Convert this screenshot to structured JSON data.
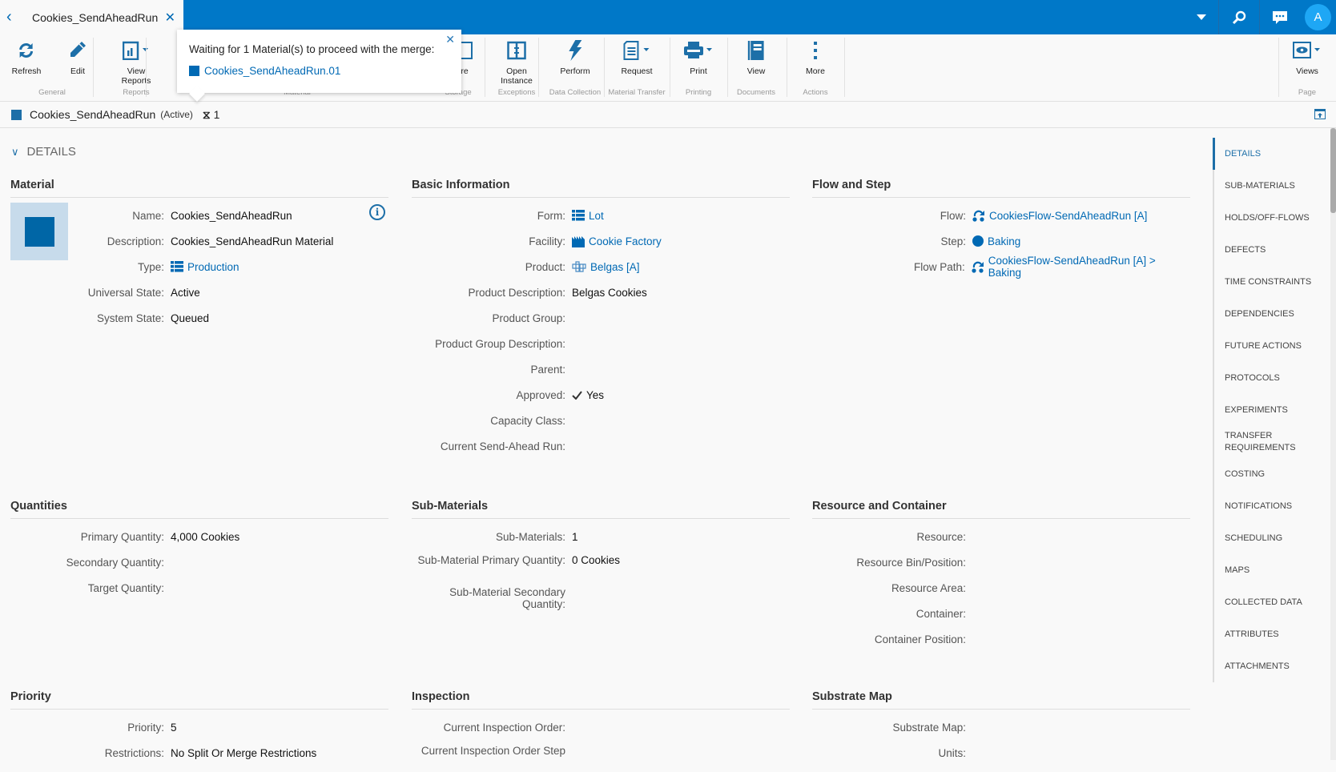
{
  "tab": {
    "title": "Cookies_SendAheadRun"
  },
  "header": {
    "avatar": "A"
  },
  "toolbar": {
    "buttons": [
      {
        "label": "Refresh",
        "icon": "refresh-icon"
      },
      {
        "label": "Edit",
        "icon": "pencil-icon"
      },
      {
        "label": "View Reports",
        "icon": "report-icon"
      },
      {
        "label": "re",
        "icon": "store-icon"
      },
      {
        "label": "Open Instance",
        "icon": "exception-icon"
      },
      {
        "label": "Perform",
        "icon": "lightning-icon"
      },
      {
        "label": "Request",
        "icon": "document-icon"
      },
      {
        "label": "Print",
        "icon": "printer-icon"
      },
      {
        "label": "View",
        "icon": "book-icon"
      },
      {
        "label": "More",
        "icon": "more-icon"
      },
      {
        "label": "Views",
        "icon": "eye-icon"
      }
    ],
    "groups": [
      "General",
      "Reports",
      "Material",
      "Storage",
      "Exceptions",
      "Data Collection",
      "Material Transfer",
      "Printing",
      "Documents",
      "Actions",
      "Page"
    ]
  },
  "popup": {
    "message": "Waiting for 1 Material(s) to proceed with the merge:",
    "link": "Cookies_SendAheadRun.01"
  },
  "material_bar": {
    "name": "Cookies_SendAheadRun",
    "state": "(Active)",
    "count": "1"
  },
  "details": {
    "heading": "DETAILS"
  },
  "sections": {
    "material": {
      "title": "Material",
      "rows": [
        {
          "label": "Name:",
          "value": "Cookies_SendAheadRun"
        },
        {
          "label": "Description:",
          "value": "Cookies_SendAheadRun Material"
        },
        {
          "label": "Type:",
          "value": "Production"
        },
        {
          "label": "Universal State:",
          "value": "Active"
        },
        {
          "label": "System State:",
          "value": "Queued"
        }
      ]
    },
    "basic": {
      "title": "Basic Information",
      "rows": [
        {
          "label": "Form:",
          "value": "Lot"
        },
        {
          "label": "Facility:",
          "value": "Cookie Factory"
        },
        {
          "label": "Product:",
          "value": "Belgas [A]"
        },
        {
          "label": "Product Description:",
          "value": "Belgas Cookies"
        },
        {
          "label": "Product Group:",
          "value": ""
        },
        {
          "label": "Product Group Description:",
          "value": ""
        },
        {
          "label": "Parent:",
          "value": ""
        },
        {
          "label": "Approved:",
          "value": "Yes"
        },
        {
          "label": "Capacity Class:",
          "value": ""
        },
        {
          "label": "Current Send-Ahead Run:",
          "value": ""
        }
      ]
    },
    "flow": {
      "title": "Flow and Step",
      "rows": [
        {
          "label": "Flow:",
          "value": "CookiesFlow-SendAheadRun [A]"
        },
        {
          "label": "Step:",
          "value": "Baking"
        },
        {
          "label": "Flow Path:",
          "value": "CookiesFlow-SendAheadRun [A] > Baking"
        }
      ]
    },
    "quantities": {
      "title": "Quantities",
      "rows": [
        {
          "label": "Primary Quantity:",
          "value": "4,000  Cookies"
        },
        {
          "label": "Secondary Quantity:",
          "value": ""
        },
        {
          "label": "Target Quantity:",
          "value": ""
        }
      ]
    },
    "submaterials": {
      "title": "Sub-Materials",
      "rows": [
        {
          "label": "Sub-Materials:",
          "value": "1"
        },
        {
          "label": "Sub-Material Primary Quantity:",
          "value": "0 Cookies"
        },
        {
          "label": "Sub-Material Secondary Quantity:",
          "value": ""
        }
      ]
    },
    "resource": {
      "title": "Resource and Container",
      "rows": [
        {
          "label": "Resource:",
          "value": ""
        },
        {
          "label": "Resource Bin/Position:",
          "value": ""
        },
        {
          "label": "Resource Area:",
          "value": ""
        },
        {
          "label": "Container:",
          "value": ""
        },
        {
          "label": "Container Position:",
          "value": ""
        }
      ]
    },
    "priority": {
      "title": "Priority",
      "rows": [
        {
          "label": "Priority:",
          "value": "5"
        },
        {
          "label": "Restrictions:",
          "value": "No Split Or Merge Restrictions"
        }
      ]
    },
    "inspection": {
      "title": "Inspection",
      "rows": [
        {
          "label": "Current Inspection Order:",
          "value": ""
        },
        {
          "label": "Current Inspection Order Step",
          "value": ""
        }
      ]
    },
    "substrate": {
      "title": "Substrate Map",
      "rows": [
        {
          "label": "Substrate Map:",
          "value": ""
        },
        {
          "label": "Units:",
          "value": ""
        }
      ]
    }
  },
  "nav": [
    "DETAILS",
    "SUB-MATERIALS",
    "HOLDS/OFF-FLOWS",
    "DEFECTS",
    "TIME CONSTRAINTS",
    "DEPENDENCIES",
    "FUTURE ACTIONS",
    "PROTOCOLS",
    "EXPERIMENTS",
    "TRANSFER REQUIREMENTS",
    "COSTING",
    "NOTIFICATIONS",
    "SCHEDULING",
    "MAPS",
    "COLLECTED DATA",
    "ATTRIBUTES",
    "ATTACHMENTS"
  ],
  "colors": {
    "brand": "#0078c8",
    "link": "#0069b4"
  }
}
